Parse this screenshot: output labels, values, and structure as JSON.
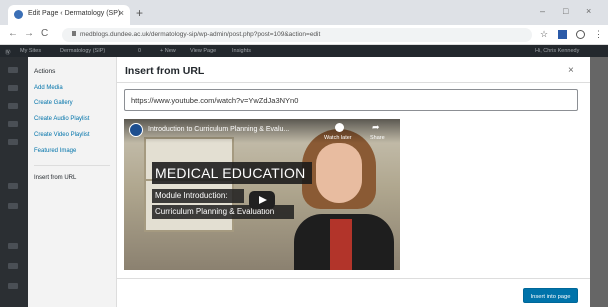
{
  "browser": {
    "tab_title": "Edit Page ‹ Dermatology (SP)",
    "tab_close": "×",
    "new_tab": "+",
    "win_minimize": "–",
    "win_maximize": "□",
    "win_close": "×",
    "back": "←",
    "forward": "→",
    "reload": "C",
    "url": "medblogs.dundee.ac.uk/dermatology-sip/wp-admin/post.php?post=109&action=edit",
    "star": "☆",
    "menu": "⋮"
  },
  "admin_bar": {
    "site": "My Sites",
    "site_name": "Dermatology (SIP)",
    "comments": "0",
    "new": "+ New",
    "view_page": "View Page",
    "insights": "Insights",
    "user": "Hi, Chris Kennedy"
  },
  "modal": {
    "menu_title": "Actions",
    "menu_items": [
      "Add Media",
      "Create Gallery",
      "Create Audio Playlist",
      "Create Video Playlist",
      "Featured Image"
    ],
    "active_item": "Insert from URL",
    "title": "Insert from URL",
    "close": "×",
    "url_value": "https://www.youtube.com/watch?v=YwZdJa3NYn0",
    "insert_button": "Insert into page"
  },
  "video": {
    "title": "Introduction to Curriculum Planning & Evalu...",
    "watch_later": "Watch later",
    "share": "Share",
    "headline": "MEDICAL EDUCATION",
    "subtitle1": "Module Introduction:",
    "subtitle2": "Curriculum Planning & Evaluation"
  },
  "colors": {
    "accent": "#0073aa",
    "admin_bar": "#23282d",
    "menu_bg": "#f3f3f3"
  }
}
